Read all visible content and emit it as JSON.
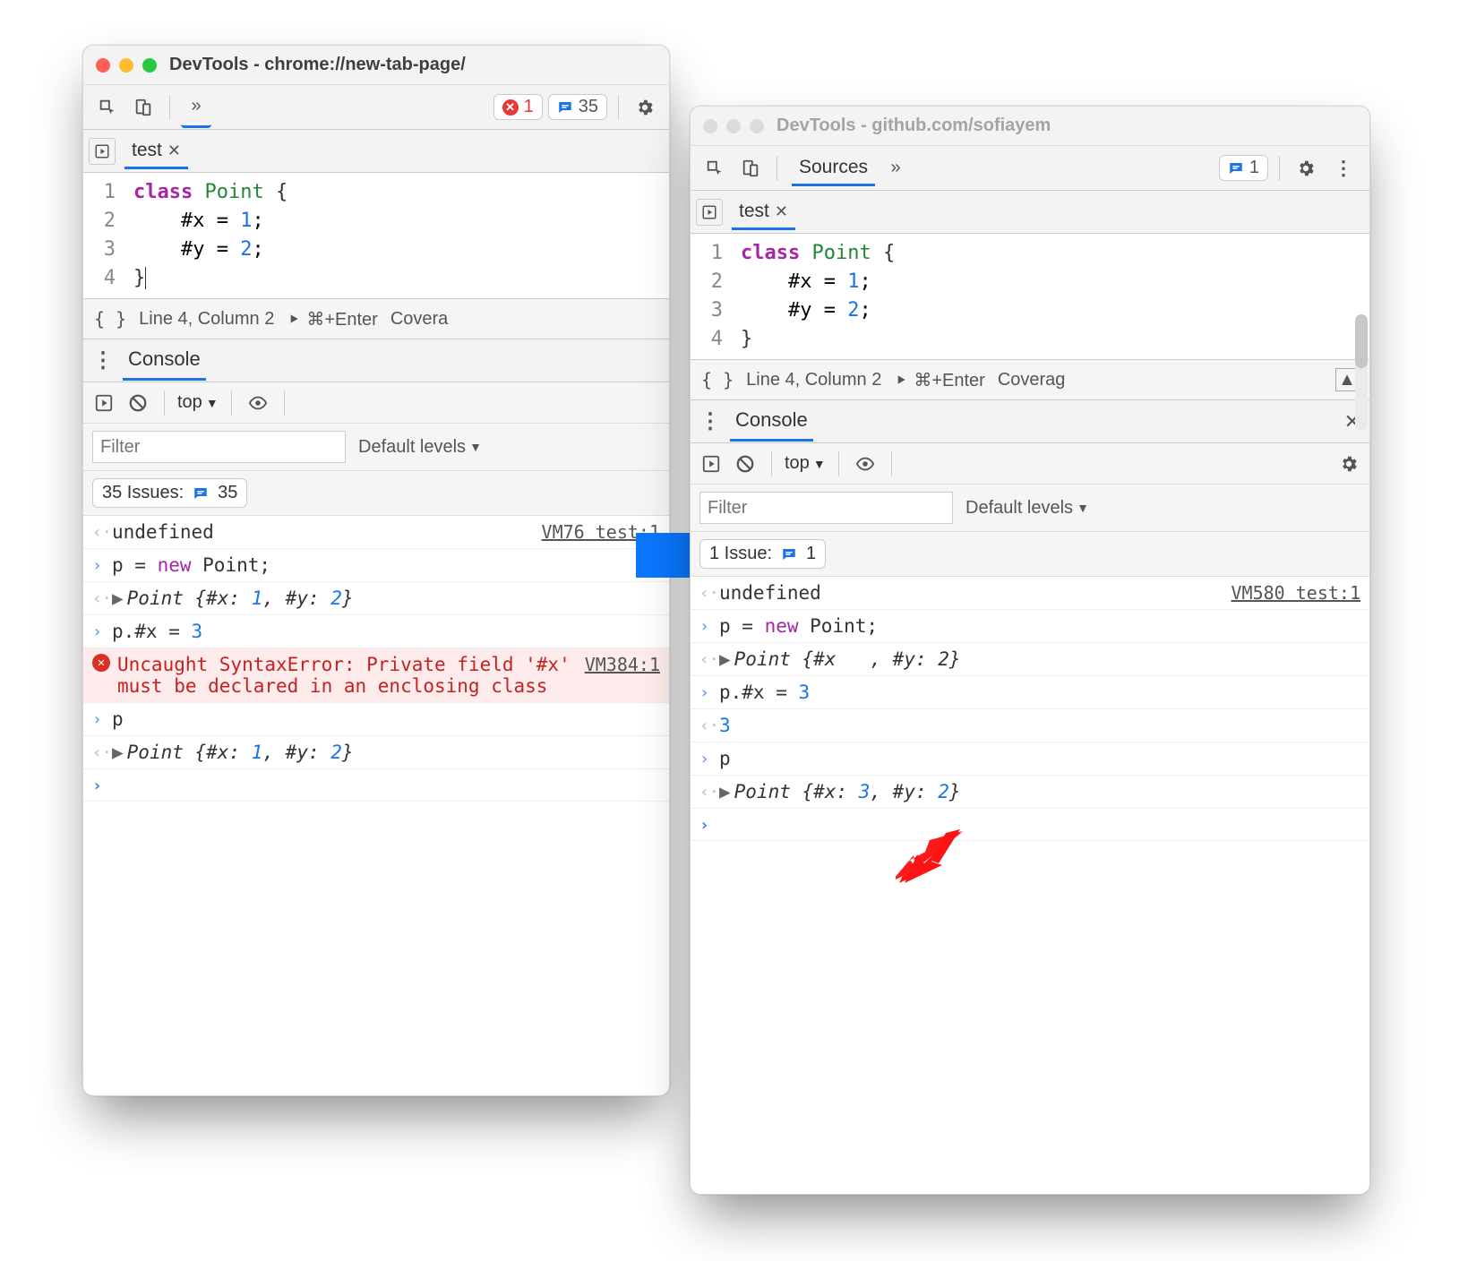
{
  "left": {
    "title": "DevTools - chrome://new-tab-page/",
    "errors_count": "1",
    "messages_count": "35",
    "sources_tab": "test",
    "code_lines": [
      {
        "n": "1",
        "raw": "class Point {"
      },
      {
        "n": "2",
        "raw": "    #x = 1;"
      },
      {
        "n": "3",
        "raw": "    #y = 2;"
      },
      {
        "n": "4",
        "raw": "}"
      }
    ],
    "status": {
      "line": "Line 4, Column 2",
      "shortcut": "⌘+Enter",
      "coverage": "Covera"
    },
    "console_tab": "Console",
    "top": "top",
    "filter_placeholder": "Filter",
    "levels": "Default levels",
    "issues_label": "35 Issues:",
    "issues_count": "35",
    "log": {
      "undef_src": "VM76 test:1",
      "undef": "undefined",
      "l1": "p = new Point;",
      "l2": "Point {#x: 1, #y: 2}",
      "l3": "p.#x = 3",
      "err": "Uncaught SyntaxError: Private field '#x' must be declared in an enclosing class",
      "err_src": "VM384:1",
      "l5": "p",
      "l6": "Point {#x: 1, #y: 2}"
    }
  },
  "right": {
    "title": "DevTools - github.com/sofiayem",
    "sources_label": "Sources",
    "messages_count": "1",
    "sources_tab": "test",
    "code_lines": [
      {
        "n": "1"
      },
      {
        "n": "2"
      },
      {
        "n": "3"
      },
      {
        "n": "4"
      }
    ],
    "status": {
      "line": "Line 4, Column 2",
      "shortcut": "⌘+Enter",
      "coverage": "Coverag"
    },
    "console_tab": "Console",
    "top": "top",
    "filter_placeholder": "Filter",
    "levels": "Default levels",
    "issues_label": "1 Issue:",
    "issues_count": "1",
    "log": {
      "undef_src": "VM580 test:1",
      "undef": "undefined",
      "l1": "p = new Point;",
      "l2_a": "Point {#x",
      "l2_b": ", #y: 2}",
      "l3": "p.#x = 3",
      "l4": "3",
      "l5": "p",
      "l6": "Point {#x: 3, #y: 2}"
    }
  }
}
